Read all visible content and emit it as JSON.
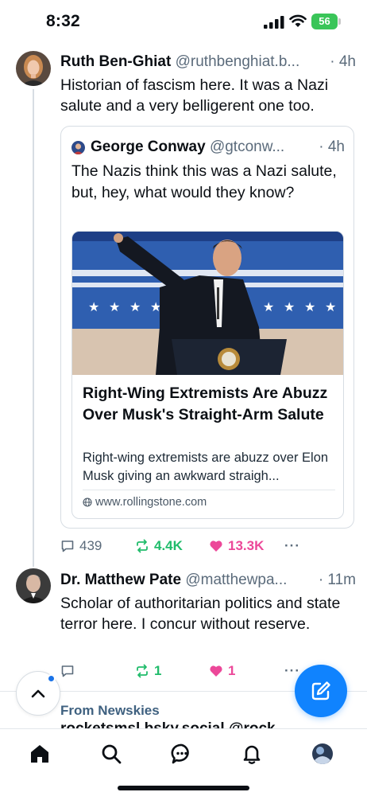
{
  "status_bar": {
    "time": "8:32",
    "battery": "56"
  },
  "post1": {
    "author_name": "Ruth Ben-Ghiat",
    "author_handle": "@ruthbenghiat.b...",
    "time_ago": "· 4h",
    "text": "Historian of fascism here. It was a Nazi salute and a very belligerent one too.",
    "quote": {
      "author_name": "George Conway",
      "author_handle": "@gtconw...",
      "time_ago": "· 4h",
      "text": "The Nazis think this was a Nazi salute, but, hey, what would they know?",
      "link": {
        "title": "Right-Wing Extremists Are Abuzz Over Musk's Straight-Arm Salute",
        "description": "Right-wing extremists are abuzz over Elon Musk giving an awkward straigh...",
        "domain": "www.rollingstone.com"
      }
    },
    "replies": "439",
    "reposts": "4.4K",
    "likes": "13.3K",
    "more": "···"
  },
  "post2": {
    "author_name": "Dr. Matthew Pate",
    "author_handle": "@matthewpa...",
    "time_ago": "· 11m",
    "text": "Scholar of authoritarian politics and state terror here. I concur without reserve.",
    "replies": "",
    "reposts": "1",
    "likes": "1",
    "more": "···"
  },
  "feed_context": {
    "from_label": "From Newskies",
    "partial_author": "rocketsmsl.bsky.social @rock..."
  },
  "tabs": [
    "home",
    "search",
    "chat",
    "notifications",
    "profile"
  ],
  "colors": {
    "accent": "#1083fe",
    "repost": "#20bc6b",
    "like": "#ec4899",
    "secondary_text": "#5b6b7b"
  }
}
